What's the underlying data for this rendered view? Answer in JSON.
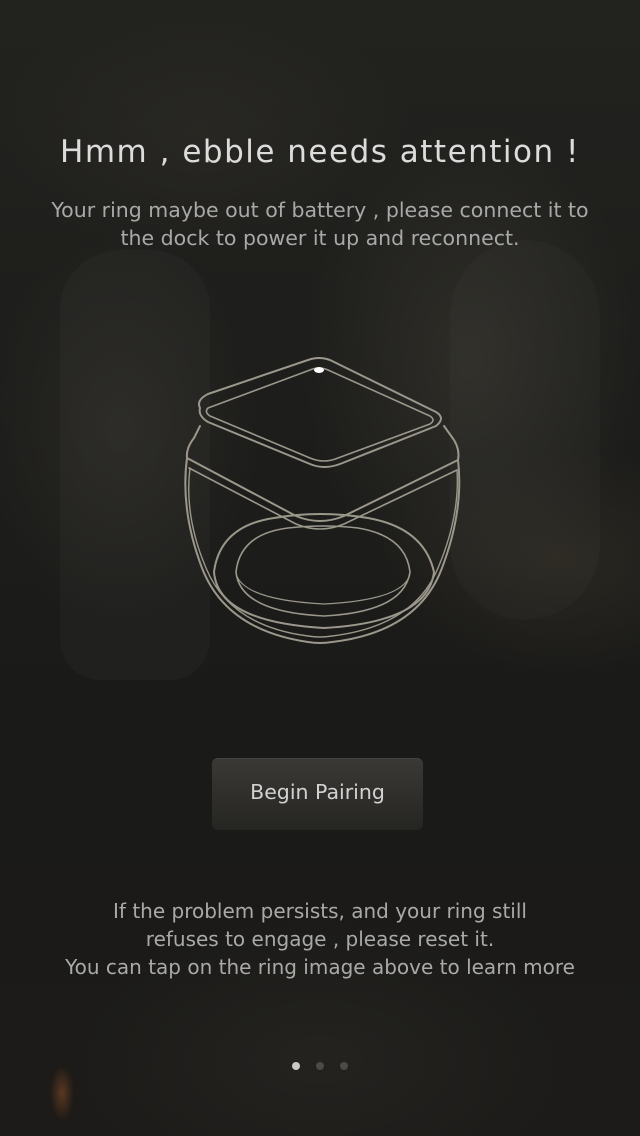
{
  "screen": {
    "title": "Hmm , ebble needs attention !",
    "message": "Your ring maybe out of battery , please connect it to the dock to power it up and reconnect."
  },
  "ring_image": {
    "icon": "ring-illustration",
    "stroke_color": "#9b978b",
    "led_color": "#ffffff"
  },
  "actions": {
    "begin_pairing_label": "Begin Pairing"
  },
  "help": {
    "line1": "If the problem persists, and your ring still",
    "line2": "refuses to engage , please reset it.",
    "line3": "You can tap on the ring image above to learn more"
  },
  "pager": {
    "total": 3,
    "current": 1
  },
  "colors": {
    "background": "#1a1a18",
    "title_text": "#dcdcdc",
    "body_text": "#a9a9a9",
    "button_bg": "#33322f"
  }
}
